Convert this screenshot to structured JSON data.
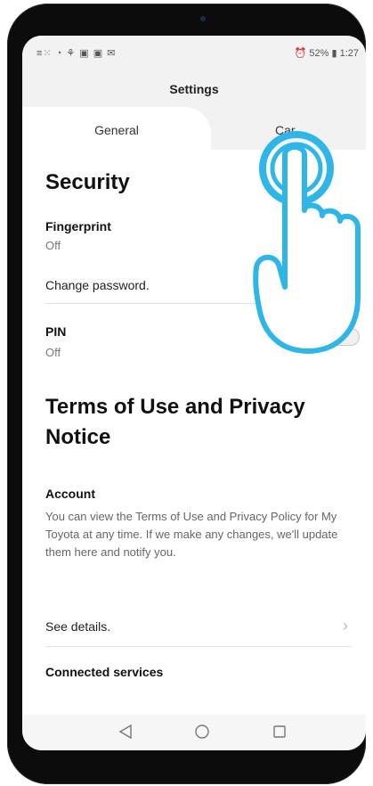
{
  "status": {
    "left_icons": "≡⁙ ◔ ⚘ ▣ ▣ ✉",
    "battery": "52%",
    "time": "1:27"
  },
  "header": {
    "title": "Settings"
  },
  "tabs": [
    {
      "label": "General"
    },
    {
      "label": "Car"
    }
  ],
  "security": {
    "heading": "Security",
    "fingerprint": {
      "label": "Fingerprint",
      "value": "Off"
    },
    "change_password": "Change password.",
    "pin": {
      "label": "PIN",
      "value": "Off",
      "enabled": false
    }
  },
  "terms": {
    "heading": "Terms of Use and Privacy Notice",
    "account_label": "Account",
    "account_text": "You can view the Terms of Use and Privacy Policy for My Toyota at any time. If we make any changes, we'll update them here and notify you.",
    "see_details": "See details.",
    "connected_services": "Connected services"
  },
  "colors": {
    "highlight": "#2fb6e8",
    "toggle_off": "#d2d2d2"
  },
  "icons": {
    "chevron": "chevron-right-icon",
    "nav_back": "back-triangle-icon",
    "nav_home": "home-circle-icon",
    "nav_recent": "recent-square-icon",
    "hand": "tap-hand-icon"
  }
}
